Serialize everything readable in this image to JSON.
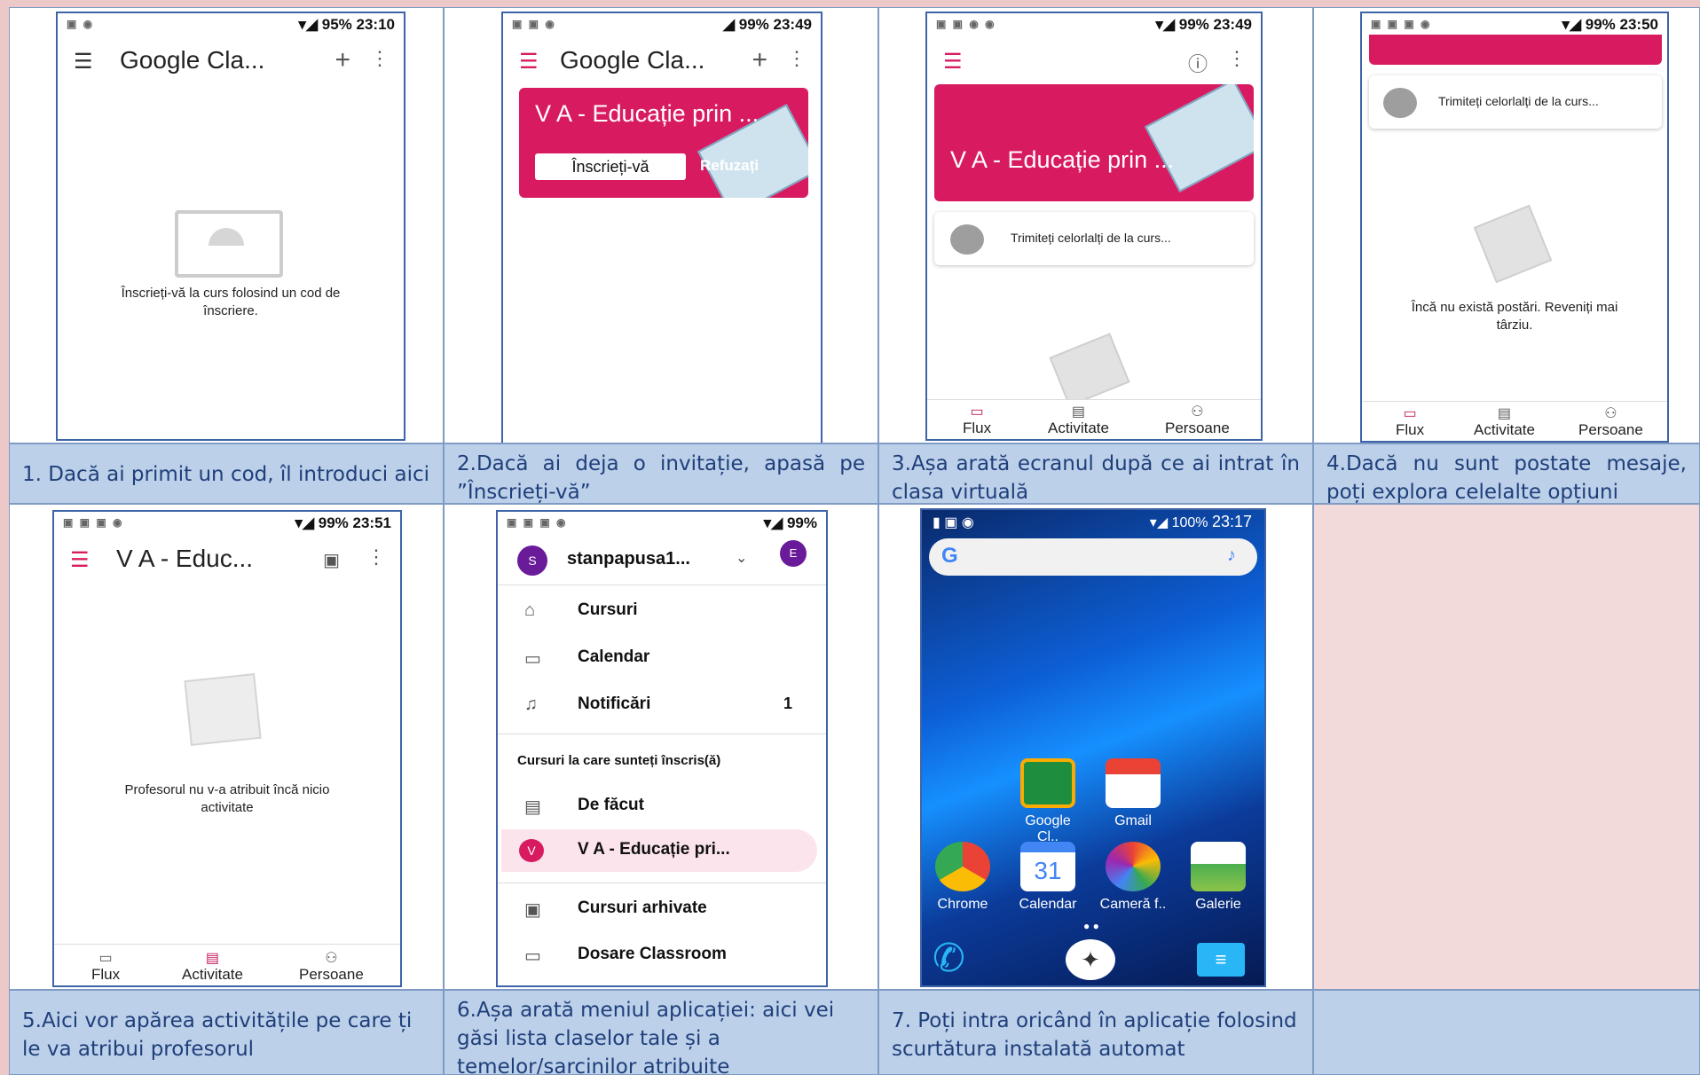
{
  "screens": {
    "s1": {
      "status_time": "23:10",
      "status_battery": "95%",
      "title": "Google Cla...",
      "empty_text": "Înscrieți-vă la curs folosind un cod de înscriere."
    },
    "s2": {
      "status_time": "23:49",
      "status_battery": "99%",
      "title": "Google Cla...",
      "banner_title": "V A - Educație prin ...",
      "join_button": "Înscrieți-vă",
      "decline_button": "Refuzați"
    },
    "s3": {
      "status_time": "23:49",
      "status_battery": "99%",
      "banner_title": "V A - Educație prin ...",
      "share_text": "Trimiteți celorlalți de la curs...",
      "nav": [
        "Flux",
        "Activitate",
        "Persoane"
      ]
    },
    "s4": {
      "status_time": "23:50",
      "status_battery": "99%",
      "share_text": "Trimiteți celorlalți de la curs...",
      "empty_text": "Încă nu există postări. Reveniți mai târziu.",
      "nav": [
        "Flux",
        "Activitate",
        "Persoane"
      ]
    },
    "s5": {
      "status_time": "23:51",
      "status_battery": "99%",
      "title": "V A - Educ...",
      "empty_text": "Profesorul nu v-a atribuit încă nicio activitate",
      "nav": [
        "Flux",
        "Activitate",
        "Persoane"
      ]
    },
    "s6": {
      "status_battery": "99%",
      "account_initial": "S",
      "account_name": "stanpapusa1...",
      "account_badge": "E",
      "items": [
        {
          "label": "Cursuri",
          "count": ""
        },
        {
          "label": "Calendar",
          "count": ""
        },
        {
          "label": "Notificări",
          "count": "1"
        }
      ],
      "section_header": "Cursuri la care sunteți înscris(ă)",
      "enrolled": [
        {
          "label": "De făcut"
        },
        {
          "label": "V A - Educație pri...",
          "initial": "V"
        }
      ],
      "bottom_items": [
        {
          "label": "Cursuri arhivate"
        },
        {
          "label": "Dosare Classroom"
        }
      ]
    },
    "s7": {
      "status_time": "23:17",
      "status_battery": "100%",
      "apps_row1": [
        "Google Cl..",
        "Gmail"
      ],
      "apps_row2": [
        "Chrome",
        "Calendar",
        "Cameră f..",
        "Galerie"
      ],
      "calendar_day": "31"
    }
  },
  "captions": {
    "c1": "1. Dacă ai primit un cod, îl introduci aici",
    "c2": "2.Dacă ai deja o invitație, apasă pe ”Înscrieți-vă”",
    "c3": "3.Așa arată ecranul după ce ai intrat în clasa virtuală",
    "c4": "4.Dacă nu sunt postate mesaje, poți explora celelalte opțiuni",
    "c5": "5.Aici vor apărea activitățile pe care ți le va atribui profesorul",
    "c6": "6.Așa arată meniul aplicației: aici vei găsi lista claselor tale și a temelor/sarcinilor atribuite",
    "c7": "7. Poți intra oricând în aplicație folosind scurtătura instalată automat"
  },
  "colors": {
    "accent": "#d81b60",
    "caption_bg": "#bcd0ea",
    "caption_text": "#1f3f7a",
    "page_bg": "#ecc8c8"
  }
}
